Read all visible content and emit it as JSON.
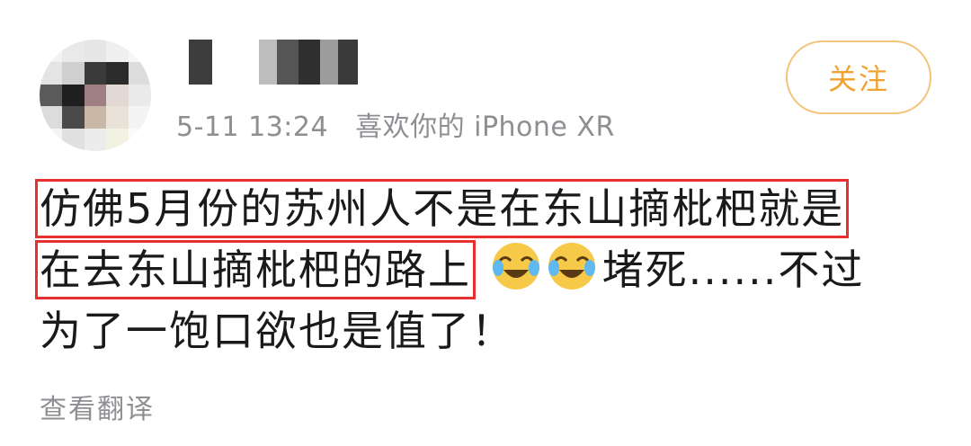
{
  "post": {
    "meta": {
      "date": "5-11 13:24",
      "device": "喜欢你的 iPhone XR"
    },
    "follow_label": "关注",
    "content": {
      "line1": "仿佛5月份的苏州人不是在东山摘枇杷就是",
      "line2_highlight": "在去东山摘枇杷的路上",
      "line2_rest": "堵死......不过",
      "line3": "为了一饱口欲也是值了！",
      "emoji_icons": [
        "laughing-crying-emoji-icon",
        "laughing-crying-emoji-icon"
      ]
    },
    "translate_label": "查看翻译"
  },
  "colors": {
    "follow_border": "#f5c37a",
    "follow_text": "#f0a332",
    "highlight_box": "#e8302f",
    "meta_text": "#8e8e93",
    "body_text": "#1a1a1a"
  }
}
